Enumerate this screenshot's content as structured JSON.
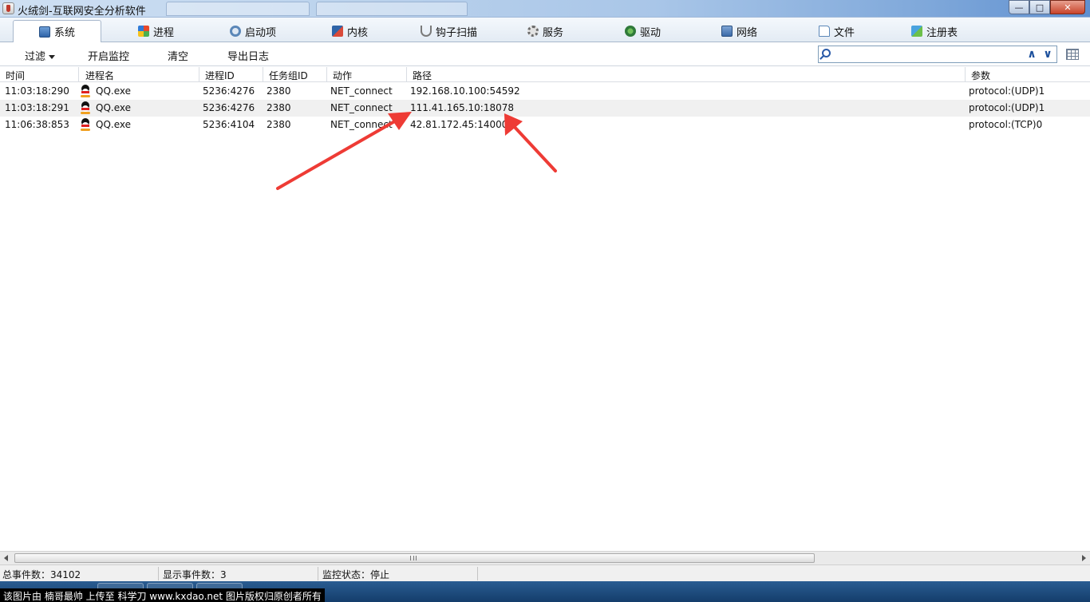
{
  "window": {
    "title": "火绒剑-互联网安全分析软件",
    "controls": {
      "minimize": "—",
      "maximize": "□",
      "close": "✕"
    }
  },
  "tabs": [
    {
      "label": "系统",
      "icon": "monitor-icon",
      "active": true
    },
    {
      "label": "进程",
      "icon": "windows-flag-icon"
    },
    {
      "label": "启动项",
      "icon": "startup-gear-icon"
    },
    {
      "label": "内核",
      "icon": "kernel-icon"
    },
    {
      "label": "钩子扫描",
      "icon": "hook-icon"
    },
    {
      "label": "服务",
      "icon": "service-gear-icon"
    },
    {
      "label": "驱动",
      "icon": "driver-icon"
    },
    {
      "label": "网络",
      "icon": "network-icon"
    },
    {
      "label": "文件",
      "icon": "file-icon"
    },
    {
      "label": "注册表",
      "icon": "registry-icon"
    }
  ],
  "toolbar": {
    "filter": "过滤",
    "start_monitor": "开启监控",
    "clear": "清空",
    "export_log": "导出日志",
    "search_placeholder": ""
  },
  "table": {
    "columns": [
      "时间",
      "进程名",
      "进程ID",
      "任务组ID",
      "动作",
      "路径",
      "参数"
    ],
    "rows": [
      {
        "time": "11:03:18:290",
        "process": "QQ.exe",
        "pid": "5236:4276",
        "group": "2380",
        "action": "NET_connect",
        "path": "192.168.10.100:54592",
        "params": "protocol:(UDP)1"
      },
      {
        "time": "11:03:18:291",
        "process": "QQ.exe",
        "pid": "5236:4276",
        "group": "2380",
        "action": "NET_connect",
        "path": "111.41.165.10:18078",
        "params": "protocol:(UDP)1"
      },
      {
        "time": "11:06:38:853",
        "process": "QQ.exe",
        "pid": "5236:4104",
        "group": "2380",
        "action": "NET_connect",
        "path": "42.81.172.45:14000",
        "params": "protocol:(TCP)0"
      }
    ]
  },
  "status": {
    "total_events": "总事件数：34102",
    "shown_events": "显示事件数：3",
    "monitor_state": "监控状态：停止"
  },
  "watermark": "该图片由 楠哥最帅 上传至 科学刀 www.kxdao.net 图片版权归原创者所有",
  "colors": {
    "arrow": "#ee3b35",
    "accent": "#1b4f9c"
  }
}
